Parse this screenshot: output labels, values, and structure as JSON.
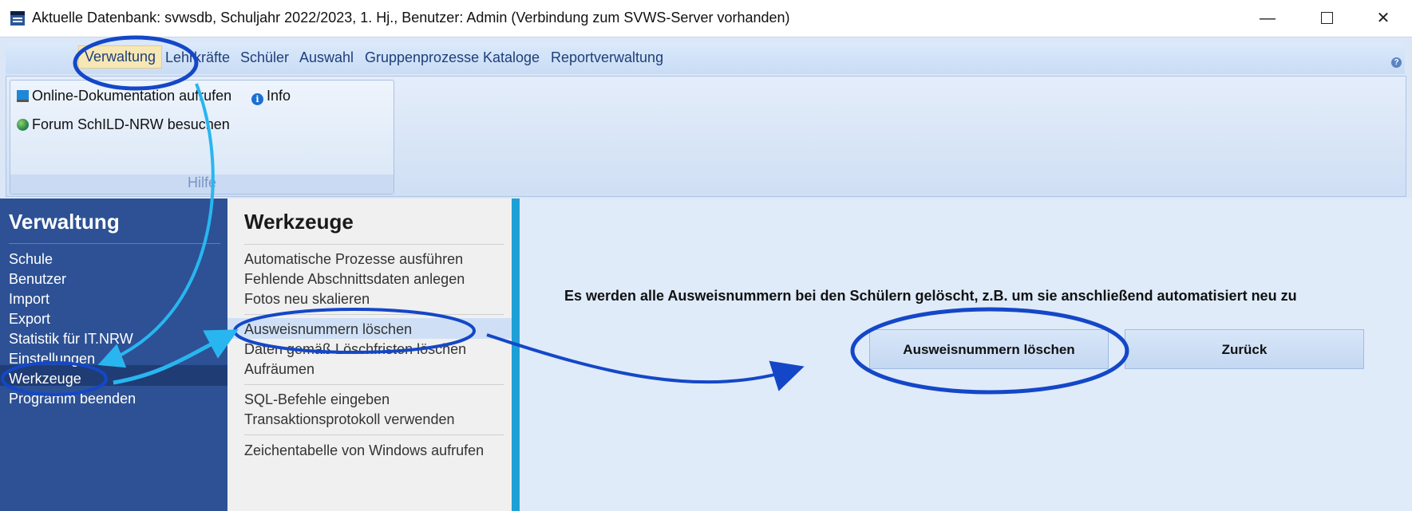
{
  "window": {
    "title": "Aktuelle Datenbank: svwsdb, Schuljahr 2022/2023, 1. Hj., Benutzer: Admin (Verbindung zum SVWS-Server vorhanden)",
    "minimize": "—",
    "close": "✕"
  },
  "ribbon": {
    "tabs": [
      "Verwaltung",
      "Lehrkräfte",
      "Schüler",
      "Auswahl",
      "Gruppenprozesse",
      "Kataloge",
      "Reportverwaltung"
    ],
    "help_icon": "?",
    "group": {
      "label": "Hilfe",
      "items": [
        {
          "label": "Online-Dokumentation aufrufen",
          "icon": "monitor-icon"
        },
        {
          "label": "Info",
          "icon": "info-icon",
          "glyph": "i"
        },
        {
          "label": "Forum SchILD-NRW besuchen",
          "icon": "globe-icon"
        }
      ]
    }
  },
  "sidebar": {
    "title": "Verwaltung",
    "items": [
      "Schule",
      "Benutzer",
      "Import",
      "Export",
      "Statistik für IT.NRW",
      "Einstellungen",
      "Werkzeuge",
      "Programm beenden"
    ],
    "selected": "Werkzeuge"
  },
  "tools": {
    "title": "Werkzeuge",
    "groups": [
      [
        "Automatische Prozesse ausführen",
        "Fehlende Abschnittsdaten anlegen",
        "Fotos neu skalieren"
      ],
      [
        "Ausweisnummern löschen",
        "Daten gemäß Löschfristen löschen",
        "Aufräumen"
      ],
      [
        "SQL-Befehle eingeben",
        "Transaktionsprotokoll verwenden"
      ],
      [
        "Zeichentabelle von Windows aufrufen"
      ]
    ],
    "selected": "Ausweisnummern löschen"
  },
  "content": {
    "description": "Es werden alle Ausweisnummern bei den Schülern gelöscht, z.B. um sie anschließend automatisiert neu zu",
    "delete_button": "Ausweisnummern löschen",
    "back_button": "Zurück"
  },
  "colors": {
    "sidebar_bg": "#2d5194",
    "accent_bar": "#1ea0d6",
    "annotation": "#1447c8",
    "annotation_light": "#29b6f0"
  }
}
